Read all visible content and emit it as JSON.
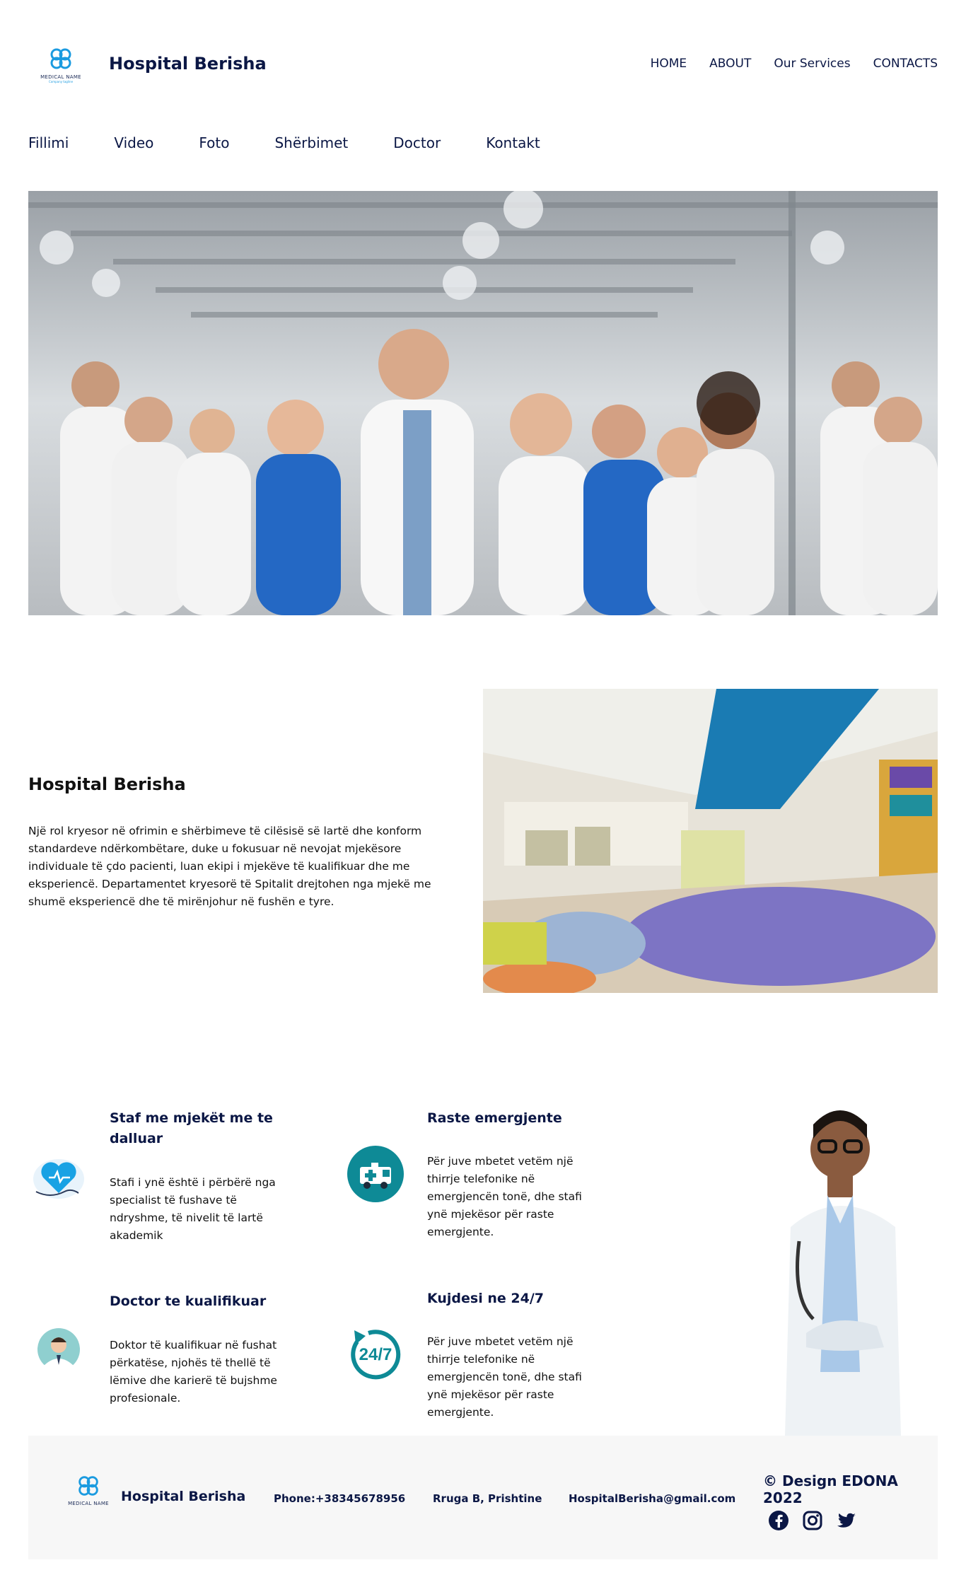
{
  "header": {
    "logo_text": "MEDICAL NAME",
    "logo_subtext": "Company tagline",
    "brand": "Hospital Berisha",
    "nav": [
      "HOME",
      "ABOUT",
      "Our Services",
      "CONTACTS"
    ]
  },
  "subnav": [
    "Fillimi",
    "Video",
    "Foto",
    "Shërbimet",
    "Doctor",
    "Kontakt"
  ],
  "about": {
    "title": "Hospital Berisha",
    "text": "Një rol kryesor në ofrimin e shërbimeve të cilësisë së lartë dhe konform standardeve ndërkombëtare, duke u fokusuar në nevojat mjekësore individuale të çdo pacienti, luan ekipi i mjekëve të kualifikuar dhe me eksperiencë. Departamentet kryesorë të Spitalit drejtohen nga mjekë me shumë eksperiencë dhe të mirënjohur në fushën e tyre."
  },
  "features": [
    {
      "title": "Staf me mjekët me te dalluar",
      "text": "Stafi i ynë është i përbërë nga specialist të fushave të ndryshme, të nivelit të lartë akademik",
      "icon": "heart-stethoscope-icon"
    },
    {
      "title": "Raste emergjente",
      "text": "Për juve mbetet vetëm një thirrje telefonike në emergjencën tonë, dhe stafi ynë mjekësor për raste emergjente.",
      "icon": "ambulance-icon"
    },
    {
      "title": "Doctor te kualifikuar",
      "text": "Doktor të kualifikuar në fushat përkatëse, njohës të thellë të lëmive dhe karierë të bujshme profesionale.",
      "icon": "doctor-avatar-icon"
    },
    {
      "title": "Kujdesi ne 24/7",
      "text": "Për juve mbetet vetëm një thirrje telefonike në emergjencën tonë, dhe stafi ynë mjekësor për raste emergjente.",
      "icon": "24-7-icon"
    }
  ],
  "badge_247": "24/7",
  "footer": {
    "logo_text": "MEDICAL NAME",
    "brand": "Hospital Berisha",
    "phone": "Phone:+38345678956",
    "address": "Rruga B, Prishtine",
    "email": "HospitalBerisha@gmail.com",
    "copyright": "© Design EDONA 2022",
    "socials": [
      "facebook-icon",
      "instagram-icon",
      "twitter-icon"
    ]
  },
  "colors": {
    "navy": "#0b1745",
    "teal": "#0e8a96",
    "accent_blue": "#1b9be0",
    "footer_bg": "#f7f7f7"
  }
}
